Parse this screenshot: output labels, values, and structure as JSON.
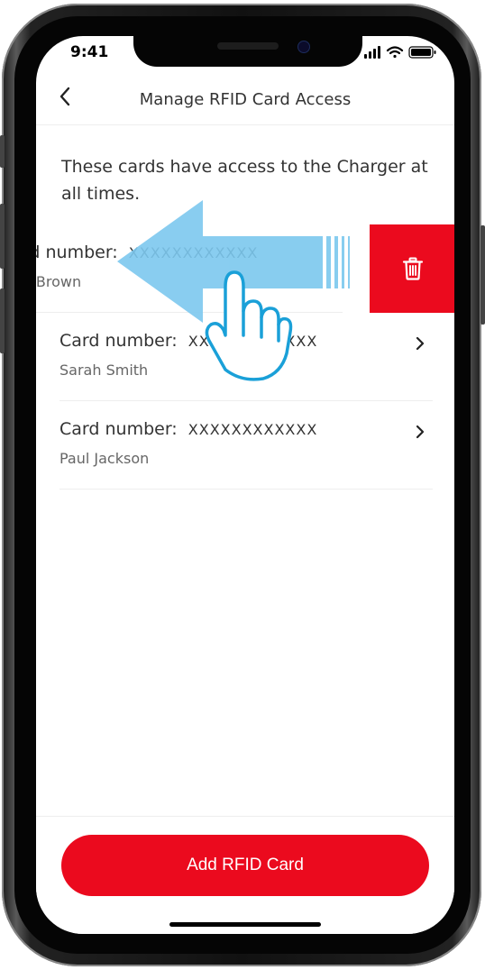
{
  "status_bar": {
    "time": "9:41"
  },
  "nav": {
    "title": "Manage RFID Card Access",
    "back_icon": "chevron-left-icon"
  },
  "description": "These cards have access to the Charger at all times.",
  "cards": [
    {
      "label": "Card number:",
      "number": "XXXXXXXXXXXX",
      "owner": "John Brown",
      "swiped": true
    },
    {
      "label": "Card number:",
      "number": "XXXXXXXXXXXX",
      "owner": "Sarah Smith",
      "swiped": false
    },
    {
      "label": "Card number:",
      "number": "XXXXXXXXXXXX",
      "owner": "Paul Jackson",
      "swiped": false
    }
  ],
  "delete_action": {
    "icon": "trash-icon"
  },
  "add_button": {
    "label": "Add RFID Card"
  },
  "colors": {
    "accent": "#eb0a1e",
    "gesture": "#7cc8ee",
    "hand_outline": "#1aa0d8",
    "text": "#333333"
  }
}
